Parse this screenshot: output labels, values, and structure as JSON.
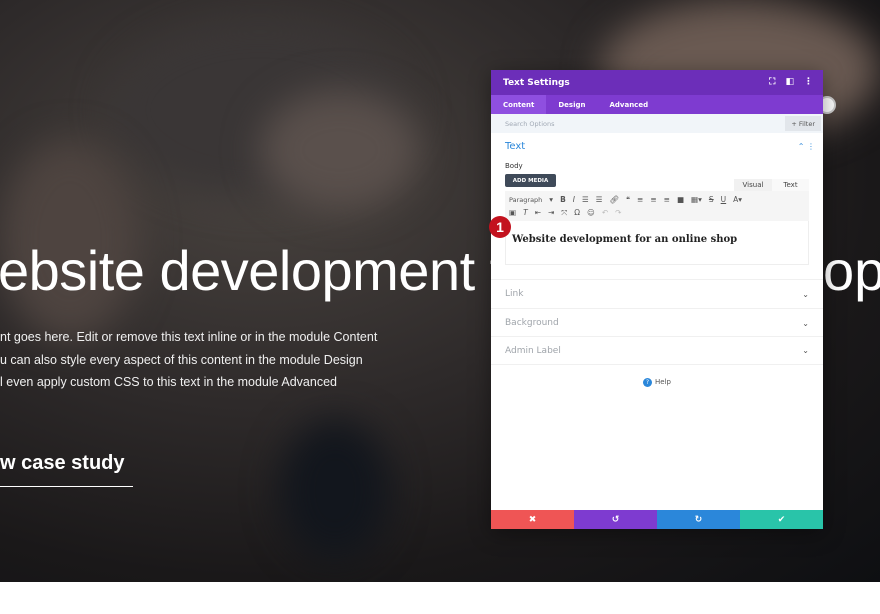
{
  "hero": {
    "heading_left": "ebsite development f",
    "heading_right": "op",
    "lines": [
      "nt goes here. Edit or remove this text inline or in the module Content",
      "u can also style every aspect of this content in the module Design",
      "l even apply custom CSS to this text in the module Advanced"
    ],
    "cta": "w case study"
  },
  "modal": {
    "title": "Text Settings",
    "header_icons": [
      "expand-icon",
      "sidebar-icon",
      "more-icon"
    ],
    "tabs": [
      {
        "label": "Content",
        "active": true
      },
      {
        "label": "Design"
      },
      {
        "label": "Advanced"
      }
    ],
    "search_placeholder": "Search Options",
    "filter_label": "+ Filter",
    "section": {
      "title": "Text",
      "body_label": "Body",
      "add_media": "ADD MEDIA",
      "visual_tab": "Visual",
      "text_tab": "Text",
      "paragraph_select": "Paragraph",
      "content": "Website development for an online shop"
    },
    "badge": "1",
    "accordions": [
      "Link",
      "Background",
      "Admin Label"
    ],
    "help": "Help",
    "colors": {
      "header": "#6c2eb9",
      "tabs": "#7e3bd0",
      "cancel": "#ef5555",
      "undo": "#7e3bd0",
      "redo": "#2b87da",
      "save": "#29c4a9",
      "accent": "#2b87da"
    }
  }
}
